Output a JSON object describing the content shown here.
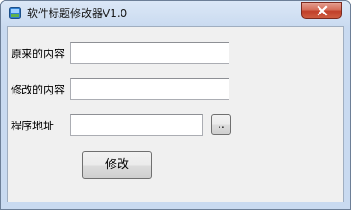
{
  "window": {
    "title": "软件标题修改器V1.0",
    "close_label": "✕"
  },
  "form": {
    "original_label": "原来的内容",
    "original_value": "",
    "modified_label": "修改的内容",
    "modified_value": "",
    "path_label": "程序地址",
    "path_value": "",
    "browse_label": "..",
    "submit_label": "修改"
  },
  "colors": {
    "title_bar": "#c9daf0",
    "close_button": "#c1402a",
    "client_bg": "#f0f0f0"
  },
  "icons": {
    "app": "app-icon",
    "close": "close-icon"
  }
}
